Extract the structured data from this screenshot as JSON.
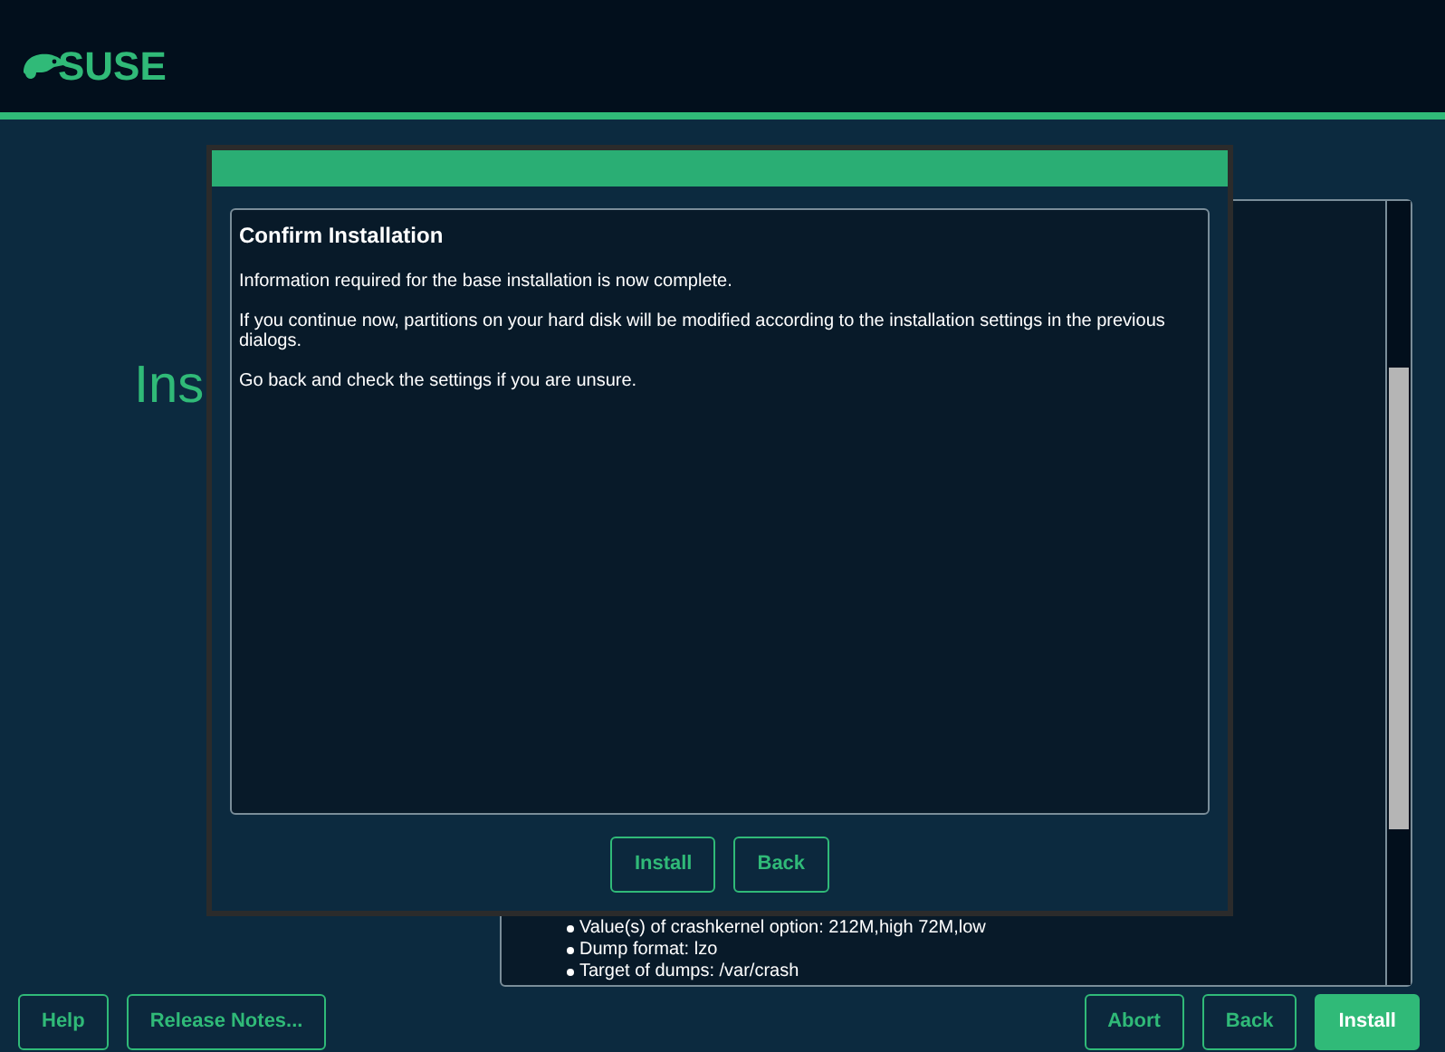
{
  "header": {
    "logo": "SUSE"
  },
  "page": {
    "heading": "Ins",
    "summary_items": [
      "Value(s) of crashkernel option: 212M,high 72M,low",
      "Dump format: lzo",
      "Target of dumps: /var/crash"
    ]
  },
  "dialog": {
    "title": "Confirm Installation",
    "paragraphs": [
      "Information required for the base installation is now complete.",
      "If you continue now, partitions on your hard disk will be modified according to the installation settings in the previous dialogs.",
      "Go back and check the settings if you are unsure."
    ],
    "buttons": [
      {
        "label": "Install",
        "primary": false
      },
      {
        "label": "Back",
        "primary": false
      }
    ]
  },
  "footer": {
    "left_buttons": [
      {
        "label": "Help",
        "primary": false
      },
      {
        "label": "Release Notes...",
        "primary": false
      }
    ],
    "right_buttons": [
      {
        "label": "Abort",
        "primary": false
      },
      {
        "label": "Back",
        "primary": false
      },
      {
        "label": "Install",
        "primary": true
      }
    ]
  }
}
